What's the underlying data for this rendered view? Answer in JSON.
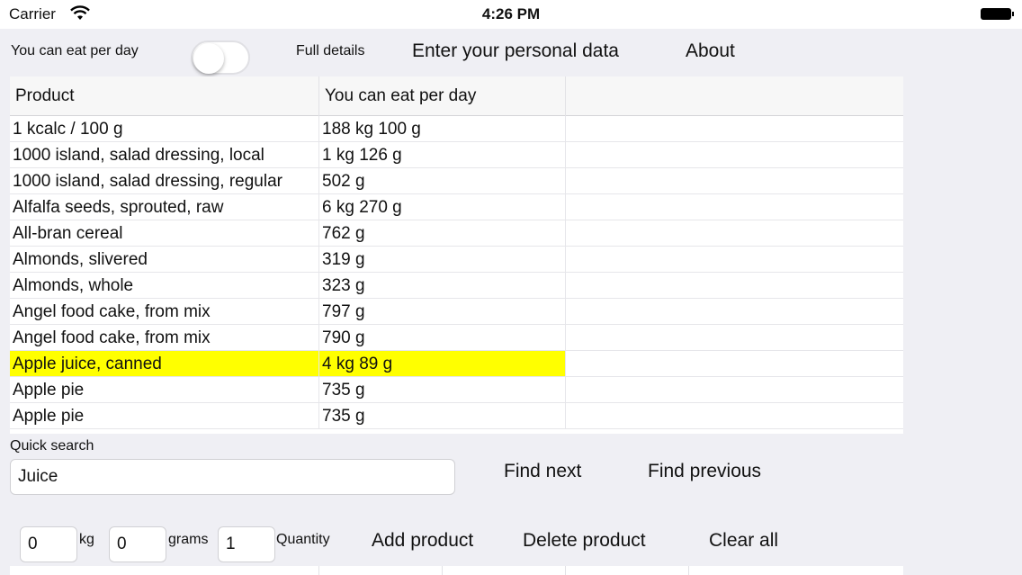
{
  "status_bar": {
    "carrier": "Carrier",
    "time": "4:26 PM"
  },
  "top_bar": {
    "eat_label": "You can eat per day",
    "full_details_label": "Full details",
    "full_details_toggle_on": false,
    "personal_data_button": "Enter your personal data",
    "about_button": "About"
  },
  "table": {
    "columns": [
      "Product",
      "You can eat per day",
      ""
    ],
    "rows": [
      {
        "product": "1 kcalc / 100 g",
        "amount": "188 kg 100 g"
      },
      {
        "product": "1000 island, salad dressing, local",
        "amount": "1 kg 126 g"
      },
      {
        "product": "1000 island, salad dressing, regular",
        "amount": "502 g"
      },
      {
        "product": "Alfalfa seeds, sprouted, raw",
        "amount": "6 kg 270 g"
      },
      {
        "product": "All-bran cereal",
        "amount": "762 g"
      },
      {
        "product": "Almonds, slivered",
        "amount": "319 g"
      },
      {
        "product": "Almonds, whole",
        "amount": "323 g"
      },
      {
        "product": "Angel food cake, from mix",
        "amount": "797 g"
      },
      {
        "product": "Angel food cake, from mix",
        "amount": "790 g"
      },
      {
        "product": "Apple juice, canned",
        "amount": "4 kg 89 g"
      },
      {
        "product": "Apple pie",
        "amount": "735 g"
      },
      {
        "product": "Apple pie",
        "amount": "735 g"
      }
    ],
    "selected_row_index": 9,
    "highlight_color": "#ffff00"
  },
  "quick_search": {
    "label": "Quick search",
    "value": "Juice",
    "find_next": "Find next",
    "find_previous": "Find previous"
  },
  "entry": {
    "kg_value": "0",
    "kg_label": "kg",
    "grams_value": "0",
    "grams_label": "grams",
    "quantity_value": "1",
    "quantity_label": "Quantity",
    "add_product": "Add product",
    "delete_product": "Delete product",
    "clear_all": "Clear all"
  }
}
